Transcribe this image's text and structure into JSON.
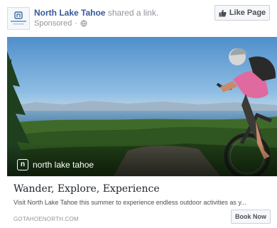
{
  "post": {
    "page_name": "North Lake Tahoe",
    "action_text": "shared a link.",
    "sponsored_label": "Sponsored",
    "privacy_icon": "globe-icon",
    "like_page_label": "Like Page",
    "like_icon": "thumbs-up-icon"
  },
  "hero": {
    "brand_text": "north lake tahoe",
    "brand_letter": "n",
    "description": "Mountain biker overlooking Lake Tahoe and pine forest"
  },
  "link": {
    "headline": "Wander, Explore, Experience",
    "description": "Visit North Lake Tahoe this summer to experience endless outdoor activities as y...",
    "domain": "GOTAHOENORTH.COM",
    "cta_label": "Book Now"
  },
  "colors": {
    "page_link": "#365899",
    "secondary_text": "#90949c",
    "button_bg": "#f6f7f9",
    "button_border": "#ccd0d5"
  }
}
